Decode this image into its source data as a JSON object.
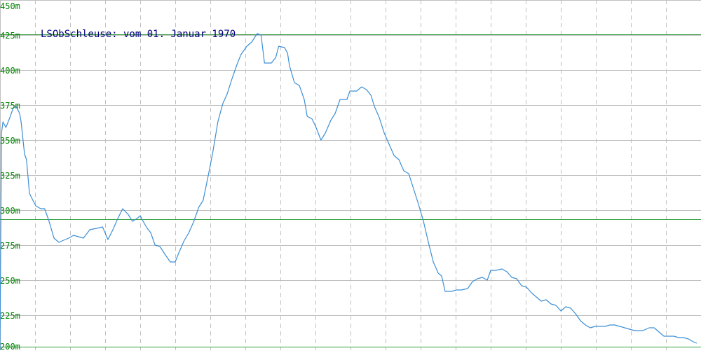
{
  "colors": {
    "background": "#ffffff",
    "grid": "#c0c0c0",
    "axis_label": "#008000",
    "reference_line": "#2e9e3a",
    "series": "#3d8fd6",
    "title": "#000080"
  },
  "chart_data": {
    "type": "line",
    "title": "LSObSchleuse: vom 01. Januar 1970",
    "xlabel": "",
    "ylabel": "",
    "ylim": [
      200,
      450
    ],
    "yticks": [
      200,
      225,
      250,
      275,
      300,
      325,
      350,
      375,
      400,
      425,
      450
    ],
    "ytick_labels": [
      "200m",
      "225m",
      "250m",
      "275m",
      "300m",
      "325m",
      "350m",
      "375m",
      "400m",
      "425m",
      "450m"
    ],
    "grid": true,
    "vertical_grid_count": 20,
    "reference_lines": [
      {
        "y": 425.5,
        "color": "#2e9e3a"
      },
      {
        "y": 293.5,
        "color": "#2e9e3a"
      },
      {
        "y": 202.5,
        "color": "#2e9e3a"
      }
    ],
    "series": [
      {
        "color": "#3d8fd6",
        "points": [
          [
            0,
            200
          ],
          [
            0.3,
            355
          ],
          [
            0.6,
            363
          ],
          [
            1.2,
            359
          ],
          [
            2,
            366
          ],
          [
            2.7,
            373
          ],
          [
            3.3,
            374
          ],
          [
            4,
            369
          ],
          [
            4.3,
            363
          ],
          [
            5,
            340
          ],
          [
            5.4,
            336
          ],
          [
            6,
            312
          ],
          [
            6.7,
            307
          ],
          [
            7.3,
            303
          ],
          [
            8.3,
            301
          ],
          [
            9.1,
            301
          ],
          [
            10,
            292
          ],
          [
            11,
            280
          ],
          [
            12,
            277
          ],
          [
            13.3,
            279
          ],
          [
            14,
            280
          ],
          [
            15,
            282
          ],
          [
            16,
            281
          ],
          [
            17,
            280
          ],
          [
            18.3,
            286
          ],
          [
            19.7,
            287
          ],
          [
            20.9,
            288
          ],
          [
            22,
            279
          ],
          [
            23,
            286
          ],
          [
            24,
            294
          ],
          [
            25,
            301
          ],
          [
            26.1,
            297
          ],
          [
            27,
            292
          ],
          [
            27.9,
            294
          ],
          [
            28.6,
            296
          ],
          [
            29,
            293
          ],
          [
            30,
            287
          ],
          [
            30.7,
            284
          ],
          [
            31.6,
            275
          ],
          [
            32.6,
            274
          ],
          [
            33.7,
            268
          ],
          [
            34.7,
            263
          ],
          [
            35.7,
            263
          ],
          [
            36.5,
            270
          ],
          [
            37.5,
            278
          ],
          [
            38.5,
            284
          ],
          [
            39.5,
            292
          ],
          [
            40.5,
            302
          ],
          [
            41.4,
            307
          ],
          [
            42.4,
            324
          ],
          [
            43.3,
            340
          ],
          [
            44.4,
            363
          ],
          [
            45.4,
            376
          ],
          [
            46.3,
            383
          ],
          [
            47.3,
            394
          ],
          [
            48.3,
            404
          ],
          [
            49.1,
            411
          ],
          [
            50.3,
            417
          ],
          [
            51.3,
            420
          ],
          [
            52.4,
            426
          ],
          [
            53.2,
            425
          ],
          [
            53.9,
            405
          ],
          [
            55.3,
            405
          ],
          [
            56.2,
            409
          ],
          [
            56.8,
            417
          ],
          [
            58,
            416
          ],
          [
            58.6,
            412
          ],
          [
            59,
            403
          ],
          [
            60,
            391
          ],
          [
            61,
            389
          ],
          [
            62,
            379
          ],
          [
            62.6,
            367
          ],
          [
            63.6,
            365
          ],
          [
            64.3,
            360
          ],
          [
            65.4,
            350
          ],
          [
            66.3,
            355
          ],
          [
            67.4,
            364
          ],
          [
            68.3,
            369
          ],
          [
            69.3,
            379
          ],
          [
            70.7,
            379
          ],
          [
            71.3,
            385
          ],
          [
            72.7,
            385
          ],
          [
            73.7,
            388
          ],
          [
            74.7,
            386
          ],
          [
            75.6,
            382
          ],
          [
            76.3,
            374
          ],
          [
            77.3,
            366
          ],
          [
            78.3,
            355
          ],
          [
            79.3,
            347
          ],
          [
            80.3,
            339
          ],
          [
            81.3,
            336
          ],
          [
            82.3,
            328
          ],
          [
            83.3,
            326
          ],
          [
            84.3,
            315
          ],
          [
            85.3,
            304
          ],
          [
            86.3,
            292
          ],
          [
            87.3,
            277
          ],
          [
            88.3,
            263
          ],
          [
            89.3,
            255
          ],
          [
            90,
            253
          ],
          [
            90.7,
            242
          ],
          [
            92,
            242
          ],
          [
            93,
            243
          ],
          [
            94,
            243
          ],
          [
            95.3,
            244
          ],
          [
            96.3,
            249
          ],
          [
            97.3,
            251
          ],
          [
            98.3,
            252
          ],
          [
            99.3,
            250
          ],
          [
            100,
            257
          ],
          [
            101,
            257
          ],
          [
            102.3,
            258
          ],
          [
            103.3,
            256
          ],
          [
            104.3,
            252
          ],
          [
            105.3,
            251
          ],
          [
            106.3,
            246
          ],
          [
            107.3,
            245
          ],
          [
            108.3,
            241
          ],
          [
            109.3,
            238
          ],
          [
            110.3,
            235
          ],
          [
            111.3,
            236
          ],
          [
            112.3,
            233
          ],
          [
            113.3,
            232
          ],
          [
            114.3,
            228
          ],
          [
            115.3,
            231
          ],
          [
            116.3,
            230
          ],
          [
            117.3,
            226
          ],
          [
            118.3,
            221
          ],
          [
            119.3,
            218
          ],
          [
            120.3,
            216
          ],
          [
            121.3,
            217
          ],
          [
            122.3,
            217
          ],
          [
            123.3,
            217
          ],
          [
            124.3,
            218
          ],
          [
            125.3,
            218
          ],
          [
            126.3,
            217
          ],
          [
            127.3,
            216
          ],
          [
            128.3,
            215
          ],
          [
            129.3,
            214
          ],
          [
            130,
            214
          ],
          [
            131,
            214
          ],
          [
            132.3,
            216
          ],
          [
            133.3,
            216
          ],
          [
            134.3,
            213
          ],
          [
            135.3,
            210
          ],
          [
            136.3,
            210
          ],
          [
            137.3,
            210
          ],
          [
            138.3,
            209
          ],
          [
            139.3,
            209
          ],
          [
            140.3,
            208
          ],
          [
            141.3,
            206
          ],
          [
            142,
            205
          ]
        ]
      }
    ]
  }
}
